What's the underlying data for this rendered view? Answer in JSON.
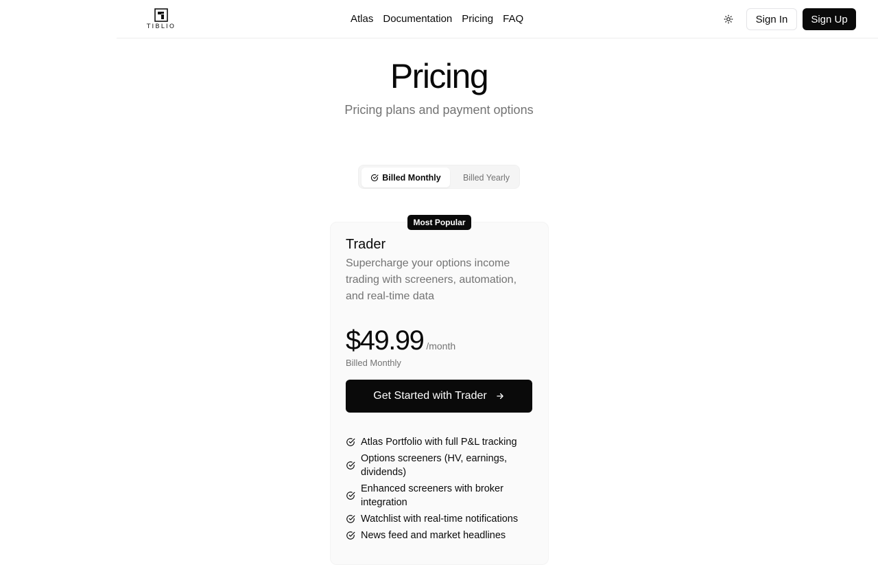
{
  "header": {
    "logo_text": "TIBLIO",
    "nav": [
      "Atlas",
      "Documentation",
      "Pricing",
      "FAQ"
    ],
    "sign_in": "Sign In",
    "sign_up": "Sign Up"
  },
  "hero": {
    "title": "Pricing",
    "subtitle": "Pricing plans and payment options"
  },
  "billing_toggle": {
    "monthly": "Billed Monthly",
    "yearly": "Billed Yearly",
    "selected": "monthly"
  },
  "plan": {
    "badge": "Most Popular",
    "name": "Trader",
    "description": "Supercharge your options income trading with screeners, automation, and real-time data",
    "price": "$49.99",
    "period": "/month",
    "billing_note": "Billed Monthly",
    "cta": "Get Started with Trader",
    "features": [
      "Atlas Portfolio with full P&L tracking",
      "Options screeners (HV, earnings, dividends)",
      "Enhanced screeners with broker integration",
      "Watchlist with real-time notifications",
      "News feed and market headlines"
    ]
  },
  "colors": {
    "primary": "#0a0a0a",
    "muted": "#737373",
    "card_bg": "#fafafa"
  }
}
